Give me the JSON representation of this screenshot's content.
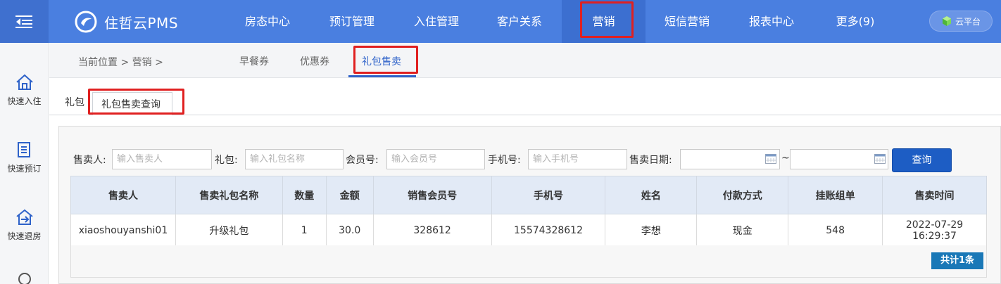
{
  "brand": {
    "name": "住哲云PMS"
  },
  "nav": {
    "items": [
      "房态中心",
      "预订管理",
      "入住管理",
      "客户关系",
      "营销",
      "短信营销",
      "报表中心",
      "更多(9)"
    ],
    "active": "营销"
  },
  "cloud_button": "云平台",
  "sidebar": {
    "items": [
      "快速入住",
      "快速预订",
      "快速退房"
    ]
  },
  "breadcrumb": {
    "label": "当前位置 > 营销 >"
  },
  "subtabs": [
    "早餐券",
    "优惠券",
    "礼包售卖"
  ],
  "tabs": [
    "礼包",
    "礼包售卖查询"
  ],
  "filters": {
    "seller": {
      "label": "售卖人:",
      "placeholder": "输入售卖人"
    },
    "package": {
      "label": "礼包:",
      "placeholder": "输入礼包名称"
    },
    "member": {
      "label": "会员号:",
      "placeholder": "输入会员号"
    },
    "phone": {
      "label": "手机号:",
      "placeholder": "输入手机号"
    },
    "date": {
      "label": "售卖日期:",
      "separator": "~"
    },
    "query_button": "查询"
  },
  "table": {
    "headers": [
      "售卖人",
      "售卖礼包名称",
      "数量",
      "金额",
      "销售会员号",
      "手机号",
      "姓名",
      "付款方式",
      "挂账组单",
      "售卖时间"
    ],
    "rows": [
      [
        "xiaoshouyanshi01",
        "升级礼包",
        "1",
        "30.0",
        "328612",
        "15574328612",
        "李想",
        "现金",
        "548",
        "2022-07-29 16:29:37"
      ]
    ]
  },
  "total_label": "共计1条",
  "colors": {
    "topbar": "#4a7fe0",
    "accent": "#2e62c9",
    "highlight": "#e02020",
    "badge": "#1a78b7"
  }
}
